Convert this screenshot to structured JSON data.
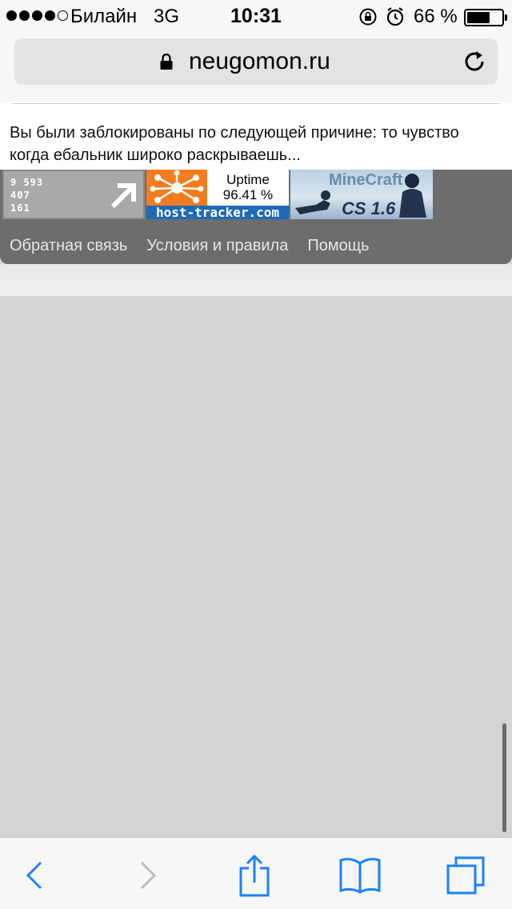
{
  "status_bar": {
    "carrier": "Билайн",
    "network": "3G",
    "time": "10:31",
    "battery_percent": "66 %",
    "battery_level": 0.66,
    "signal_bars_filled": 4,
    "signal_bars_total": 5
  },
  "address_bar": {
    "url": "neugomon.ru",
    "secure_icon": "lock-icon",
    "reload_icon": "reload-icon"
  },
  "page": {
    "block_message": "Вы были заблокированы по следующей причине: то чувство когда ебальник широко раскрываешь...",
    "counters": {
      "liveinternet": {
        "line1": "9 593",
        "line2": "407",
        "line3": "161"
      },
      "host_tracker": {
        "uptime_label": "Uptime",
        "uptime_value": "96.41 %",
        "domain": "host-tracker.com"
      },
      "game_banner": {
        "title": "MineCraft",
        "subtitle": "CS 1.6"
      }
    },
    "footer_links": [
      "Обратная связь",
      "Условия и правила",
      "Помощь"
    ]
  },
  "toolbar": {
    "back_icon": "back-icon",
    "forward_icon": "forward-icon",
    "share_icon": "share-icon",
    "bookmarks_icon": "bookmarks-icon",
    "tabs_icon": "tabs-icon"
  },
  "colors": {
    "accent": "#1a82fb",
    "footer_bg": "#6d6d6d",
    "page_bg": "#d4d4d4"
  }
}
